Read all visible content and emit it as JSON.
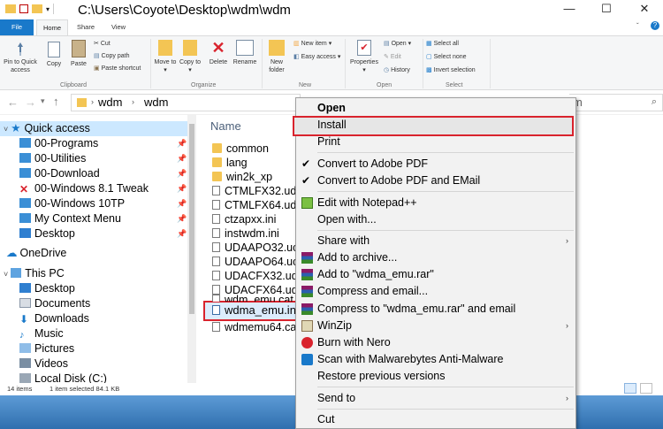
{
  "window": {
    "title": "C:\\Users\\Coyote\\Desktop\\wdm\\wdm"
  },
  "tabs": {
    "file": "File",
    "home": "Home",
    "share": "Share",
    "view": "View"
  },
  "ribbon": {
    "pin": "Pin to Quick access",
    "copy": "Copy",
    "paste": "Paste",
    "cut": "Cut",
    "copy_path": "Copy path",
    "paste_shortcut": "Paste shortcut",
    "clipboard": "Clipboard",
    "move_to": "Move to",
    "copy_to": "Copy to",
    "delete": "Delete",
    "rename": "Rename",
    "organize": "Organize",
    "new_folder": "New folder",
    "new_item": "New item",
    "easy_access": "Easy access",
    "new": "New",
    "properties": "Properties",
    "open": "Open",
    "edit": "Edit",
    "history": "History",
    "open_group": "Open",
    "select_all": "Select all",
    "select_none": "Select none",
    "invert_selection": "Invert selection",
    "select": "Select"
  },
  "address": {
    "crumbs": [
      "wdm",
      "wdm"
    ]
  },
  "nav": {
    "quick_access": "Quick access",
    "items": [
      "00-Programs",
      "00-Utilities",
      "00-Download",
      "00-Windows 8.1 Tweak",
      "00-Windows 10TP",
      "My Context Menu",
      "Desktop"
    ],
    "onedrive": "OneDrive",
    "this_pc": "This PC",
    "pc_items": [
      "Desktop",
      "Documents",
      "Downloads",
      "Music",
      "Pictures",
      "Videos",
      "Local Disk (C:)"
    ]
  },
  "files": {
    "column_name": "Name",
    "items": [
      "common",
      "lang",
      "win2k_xp",
      "CTMLFX32.uda",
      "CTMLFX64.uda",
      "ctzapxx.ini",
      "instwdm.ini",
      "UDAAPO32.uc",
      "UDAAPO64.uc",
      "UDACFX32.uda",
      "UDACFX64.ud",
      "wdm_emu.cat",
      "wdma_emu.ini",
      "wdmemu64.ca"
    ]
  },
  "status": {
    "count": "14 items",
    "selected": "1 item selected  84.1 KB"
  },
  "context_menu": {
    "open": "Open",
    "install": "Install",
    "print": "Print",
    "convert_pdf": "Convert to Adobe PDF",
    "convert_pdf_email": "Convert to Adobe PDF and EMail",
    "edit_notepad": "Edit with Notepad++",
    "open_with": "Open with...",
    "share_with": "Share with",
    "add_archive": "Add to archive...",
    "add_rar": "Add to \"wdma_emu.rar\"",
    "compress_email": "Compress and email...",
    "compress_rar_email": "Compress to \"wdma_emu.rar\" and email",
    "winzip": "WinZip",
    "burn_nero": "Burn with Nero",
    "scan_mb": "Scan with Malwarebytes Anti-Malware",
    "restore": "Restore previous versions",
    "send_to": "Send to",
    "cut": "Cut"
  },
  "colors": {
    "accent": "#1979ca",
    "highlight": "#d9232d",
    "folder": "#f3c554"
  }
}
